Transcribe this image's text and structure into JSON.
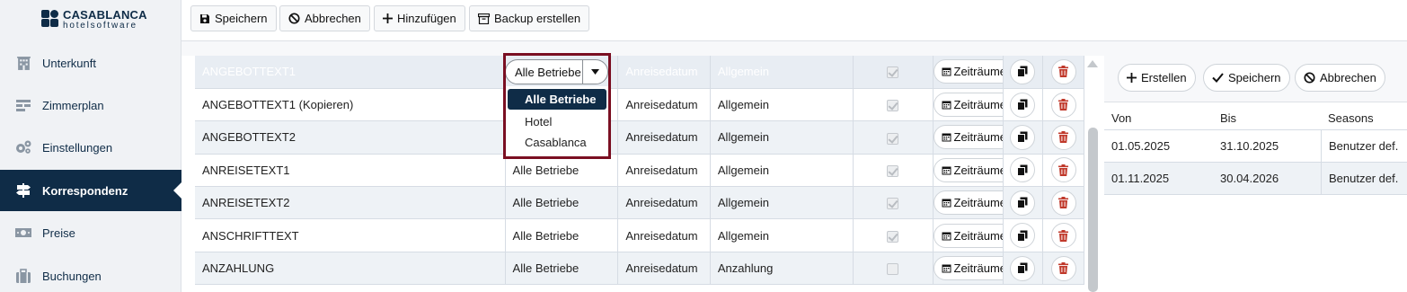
{
  "brand": {
    "name": "CASABLANCA",
    "tagline": "hotelsoftware",
    "color": "#0f2c47"
  },
  "sidebar": {
    "items": [
      {
        "label": "Unterkunft",
        "icon": "building-icon",
        "active": false
      },
      {
        "label": "Zimmerplan",
        "icon": "room-plan-icon",
        "active": false
      },
      {
        "label": "Einstellungen",
        "icon": "gears-icon",
        "active": false
      },
      {
        "label": "Korrespondenz",
        "icon": "signpost-icon",
        "active": true
      },
      {
        "label": "Preise",
        "icon": "money-icon",
        "active": false
      },
      {
        "label": "Buchungen",
        "icon": "suitcase-icon",
        "active": false
      }
    ]
  },
  "toolbar": {
    "save_label": "Speichern",
    "cancel_label": "Abbrechen",
    "add_label": "Hinzufügen",
    "backup_label": "Backup erstellen"
  },
  "grid": {
    "period_button_label": "Zeiträume",
    "rows": [
      {
        "name": "ANGEBOTTEXT1",
        "scope": "Alle Betriebe",
        "date": "Anreisedatum",
        "type": "Allgemein",
        "checked": true
      },
      {
        "name": "ANGEBOTTEXT1 (Kopieren)",
        "scope": "Alle Betriebe",
        "date": "Anreisedatum",
        "type": "Allgemein",
        "checked": true
      },
      {
        "name": "ANGEBOTTEXT2",
        "scope": "Alle Betriebe",
        "date": "Anreisedatum",
        "type": "Allgemein",
        "checked": true
      },
      {
        "name": "ANREISETEXT1",
        "scope": "Alle Betriebe",
        "date": "Anreisedatum",
        "type": "Allgemein",
        "checked": true
      },
      {
        "name": "ANREISETEXT2",
        "scope": "Alle Betriebe",
        "date": "Anreisedatum",
        "type": "Allgemein",
        "checked": true
      },
      {
        "name": "ANSCHRIFTTEXT",
        "scope": "Alle Betriebe",
        "date": "Anreisedatum",
        "type": "Allgemein",
        "checked": true
      },
      {
        "name": "ANZAHLUNG",
        "scope": "Alle Betriebe",
        "date": "Anreisedatum",
        "type": "Anzahlung",
        "checked": false
      }
    ]
  },
  "scope_select": {
    "value": "Alle Betriebe",
    "options": [
      "Alle Betriebe",
      "Hotel",
      "Casablanca"
    ]
  },
  "period_panel": {
    "create_label": "Erstellen",
    "save_label": "Speichern",
    "cancel_label": "Abbrechen",
    "headers": {
      "from": "Von",
      "to": "Bis",
      "seasons": "Seasons"
    },
    "rows": [
      {
        "from": "01.05.2025",
        "to": "31.10.2025",
        "seasons": "Benutzer def."
      },
      {
        "from": "01.11.2025",
        "to": "30.04.2026",
        "seasons": "Benutzer def."
      }
    ]
  },
  "colors": {
    "highlight_frame": "#7a0f22",
    "delete": "#c0392b",
    "accent": "#0f2c47"
  }
}
